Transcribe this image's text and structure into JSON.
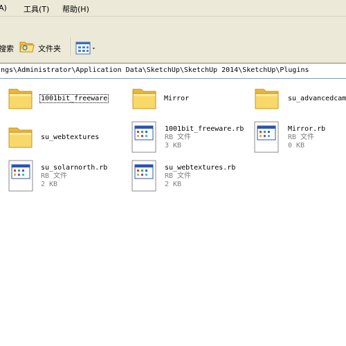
{
  "menu": {
    "partial_left": "A)",
    "tools": "工具(T)",
    "help": "帮助(H)"
  },
  "toolbar": {
    "search_partial": "搜索",
    "folders": "文件夹"
  },
  "address": {
    "path": "ngs\\Administrator\\Application Data\\SketchUp\\SketchUp 2014\\SketchUp\\Plugins"
  },
  "files": [
    {
      "name": "1001bit_freeware",
      "type": "folder"
    },
    {
      "name": "Mirror",
      "type": "folder"
    },
    {
      "name": "su_advancedcam",
      "type": "folder"
    },
    {
      "name": "su_webtextures",
      "type": "folder"
    },
    {
      "name": "1001bit_freeware.rb",
      "type": "file",
      "kind": "RB 文件",
      "size": "3 KB"
    },
    {
      "name": "Mirror.rb",
      "type": "file",
      "kind": "RB 文件",
      "size": "0 KB"
    },
    {
      "name": "su_solarnorth.rb",
      "type": "file",
      "kind": "RB 文件",
      "size": "2 KB"
    },
    {
      "name": "su_webtextures.rb",
      "type": "file",
      "kind": "RB 文件",
      "size": "2 KB"
    }
  ],
  "icons": {
    "folder": "folder-icon",
    "file": "rb-file-icon",
    "folders_button": "folders-icon",
    "views_button": "views-icon"
  },
  "colors": {
    "chrome": "#ece9d8",
    "folder_yellow": "#f6d65d",
    "address_border": "#7f9db9"
  }
}
